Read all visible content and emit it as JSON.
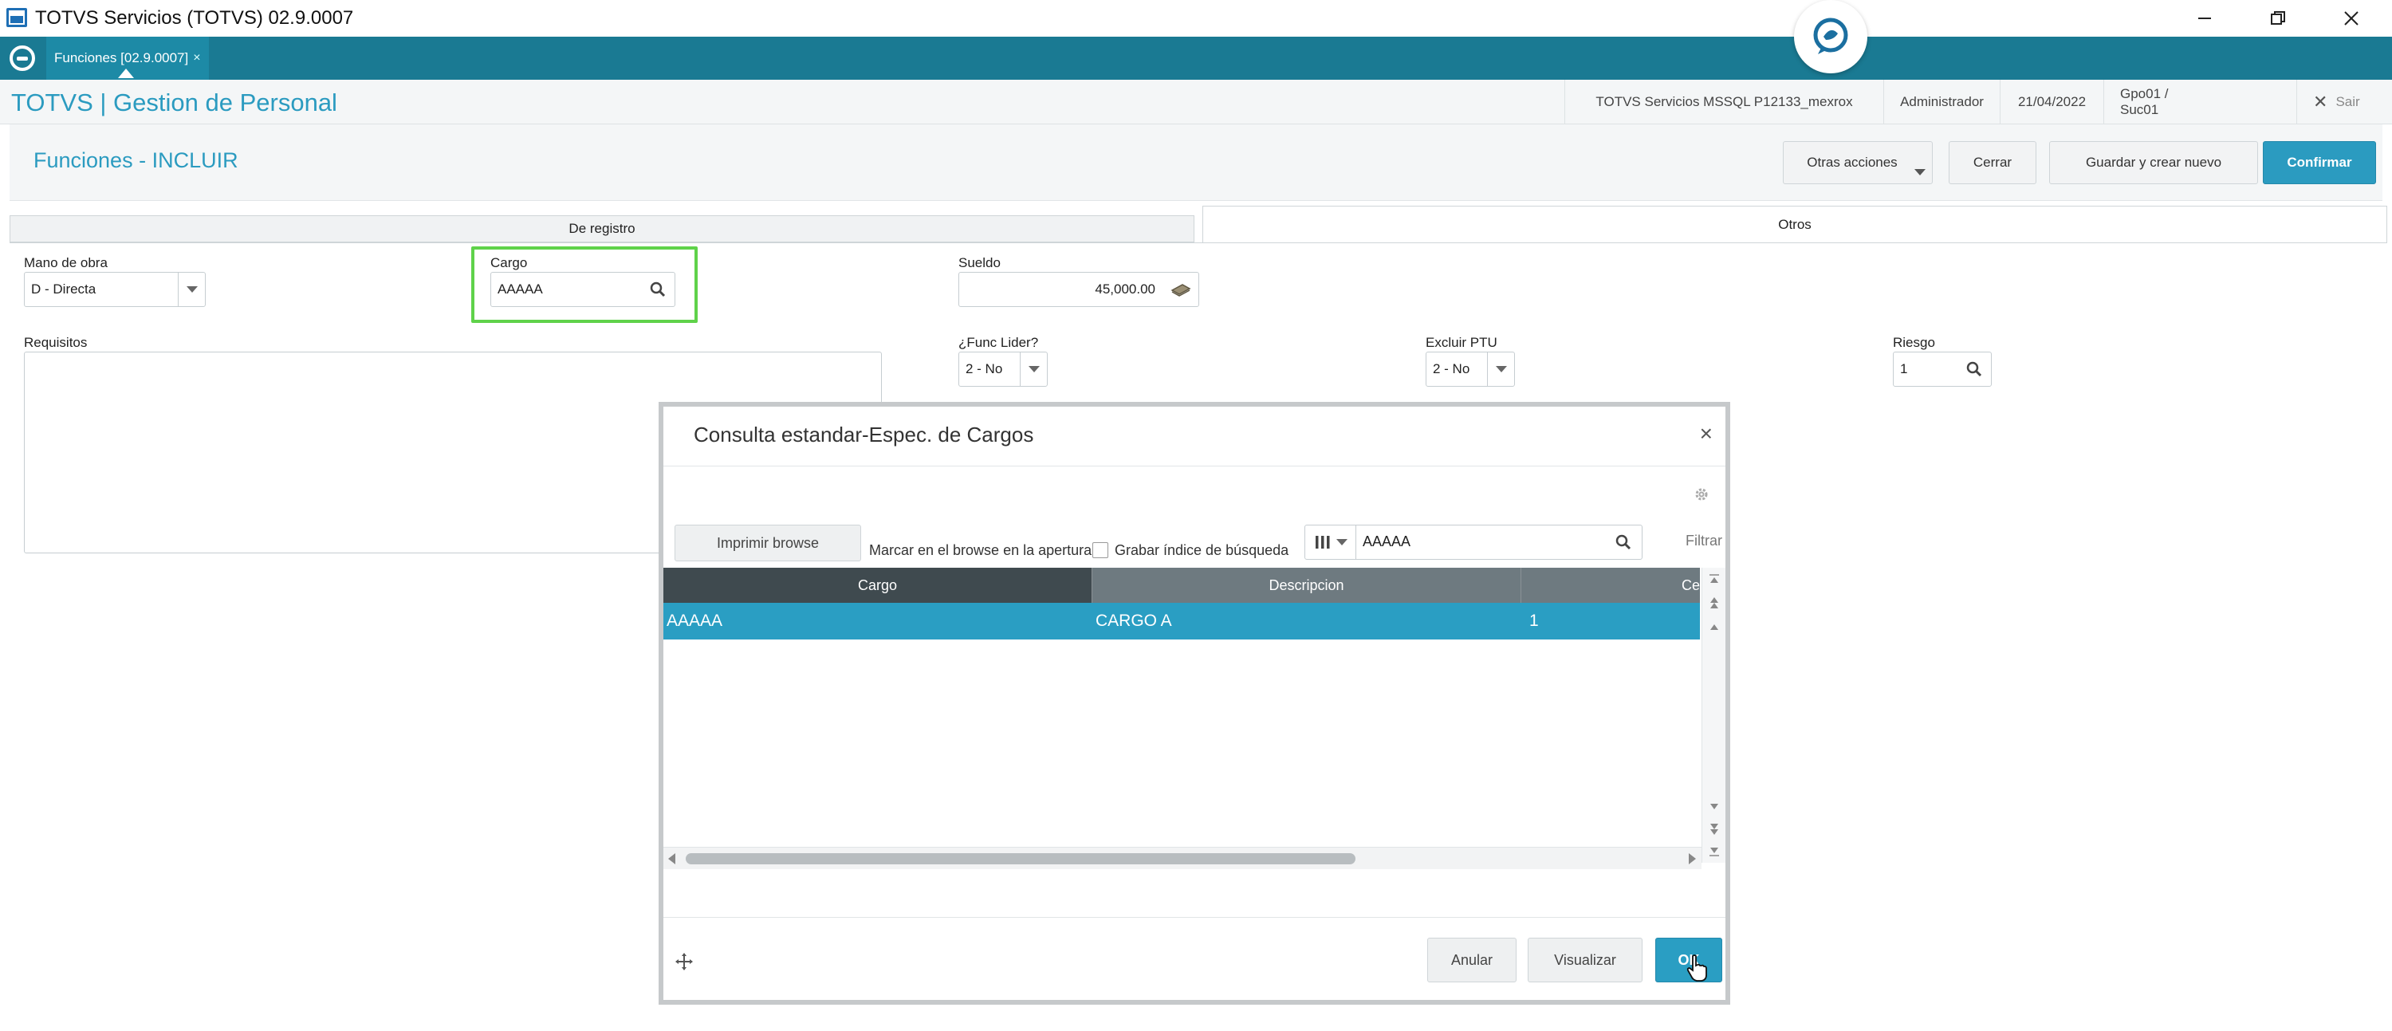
{
  "window": {
    "title": "TOTVS Servicios (TOTVS) 02.9.0007"
  },
  "topbar": {
    "tab_label": "Funciones [02.9.0007]",
    "tab_close": "×"
  },
  "header": {
    "app_title": "TOTVS | Gestion de Personal",
    "environment": "TOTVS Servicios MSSQL P12133_mexrox",
    "user": "Administrador",
    "date": "21/04/2022",
    "branch": "Gpo01 / Suc01",
    "exit_label": "Sair"
  },
  "page": {
    "title": "Funciones - INCLUIR",
    "buttons": {
      "other_actions": "Otras acciones",
      "close": "Cerrar",
      "save_new": "Guardar y crear nuevo",
      "confirm": "Confirmar"
    }
  },
  "folders": {
    "tab1": "De registro",
    "tab2": "Otros"
  },
  "form": {
    "mano_obra": {
      "label": "Mano de obra",
      "value": "D - Directa"
    },
    "cargo": {
      "label": "Cargo",
      "value": "AAAAA"
    },
    "sueldo": {
      "label": "Sueldo",
      "value": "45,000.00"
    },
    "requisitos": {
      "label": "Requisitos"
    },
    "func_lider": {
      "label": "¿Func Lider?",
      "value": "2 - No"
    },
    "excluir_ptu": {
      "label": "Excluir PTU",
      "value": "2 - No"
    },
    "riesgo": {
      "label": "Riesgo",
      "value": "1"
    }
  },
  "modal": {
    "title": "Consulta estandar-Espec. de Cargos",
    "close": "×",
    "print_button": "Imprimir browse",
    "mark_text": "Marcar en el browse en la apertura",
    "save_index_text": "Grabar índice de búsqueda",
    "search_value": "AAAAA",
    "filter_label": "Filtrar",
    "columns": [
      "Cargo",
      "Descripcion",
      "Ce"
    ],
    "rows": [
      {
        "cargo": "AAAAA",
        "descripcion": "CARGO A",
        "ce": "1"
      }
    ],
    "buttons": {
      "cancel": "Anular",
      "view": "Visualizar",
      "ok": "OK"
    }
  },
  "colors": {
    "brand_teal": "#1a7a93",
    "accent_blue": "#2b9bc0",
    "highlight_green": "#5fd24a"
  }
}
